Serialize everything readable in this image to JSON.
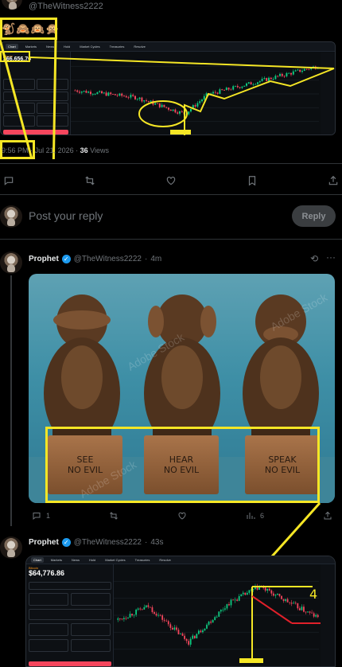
{
  "top_post": {
    "handle": "@TheWitness2222",
    "emojis": "🐒🙈🙉🙊",
    "time": "9:56 PM",
    "separator": "·",
    "date": "Jul 21, 2026",
    "views_count": "36",
    "views_label": "Views",
    "chart": {
      "symbol": "Bitcoin",
      "price": "$66,656.76",
      "tabs": [
        "Chart",
        "Markets",
        "News",
        "Hold",
        "Market Cycles",
        "Treasuries",
        "Resolve"
      ]
    }
  },
  "action_bar": {
    "reply_icon": "reply-icon",
    "repost_icon": "repost-icon",
    "like_icon": "heart-icon",
    "bookmark_icon": "bookmark-icon",
    "share_icon": "share-icon"
  },
  "composer": {
    "placeholder": "Post your reply",
    "button_label": "Reply"
  },
  "reply1": {
    "name": "Prophet",
    "handle": "@TheWitness2222",
    "dot": "·",
    "age": "4m",
    "plaques": [
      "SEE\nNO EVIL",
      "HEAR\nNO EVIL",
      "SPEAK\nNO EVIL"
    ],
    "watermark": "Adobe Stock",
    "reply_count": "1",
    "views_count": "6"
  },
  "reply2": {
    "name": "Prophet",
    "handle": "@TheWitness2222",
    "dot": "·",
    "age": "43s",
    "chart": {
      "symbol": "Bitcoin",
      "price": "$64,776.86",
      "annotation": "4",
      "tabs": [
        "Chart",
        "Markets",
        "News",
        "Hold",
        "Market Cycles",
        "Treasuries",
        "Resolve"
      ]
    }
  },
  "colors": {
    "highlight": "#f5e625",
    "verified": "#1d9bf0",
    "up_candle": "#0ecb81",
    "down_candle": "#f6465d",
    "annotation_red": "#e0202a"
  }
}
